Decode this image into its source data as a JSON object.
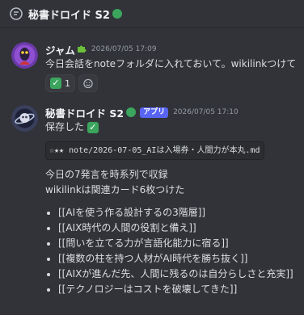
{
  "header": {
    "title": "秘書ドロイド S2",
    "thread_icon": "thread-icon",
    "status_color": "#3ba55d"
  },
  "messages": [
    {
      "author": "ジャム",
      "author_icon": "puzzle-piece-emoji",
      "timestamp": "2026/07/05 17:09",
      "text": "今日会話をnoteフォルダに入れておいて。wikilinkつけて",
      "reactions": [
        {
          "emoji": "check-mark-emoji",
          "count": "1"
        }
      ]
    },
    {
      "author": "秘書ドロイド S2",
      "badge": "アプリ",
      "timestamp": "2026/07/05 17:10",
      "line1": "保存した",
      "code": "☆★★ note/2026-07-05_AIは入場券・人間力が本丸.md",
      "line2": "今日の7発言を時系列で収録",
      "line3": "wikilinkは関連カード6枚つけた",
      "links": [
        "[[AIを使う作る設計するの3階層]]",
        "[[AIX時代の人間の役割と備え]]",
        "[[問いを立てる力が言語化能力に宿る]]",
        "[[複数の柱を持つ人材がAI時代を勝ち抜く]]",
        "[[AIXが進んだ先、人間に残るのは自分らしさと充実]]",
        "[[テクノロジーはコストを破壊してきた]]"
      ]
    }
  ]
}
